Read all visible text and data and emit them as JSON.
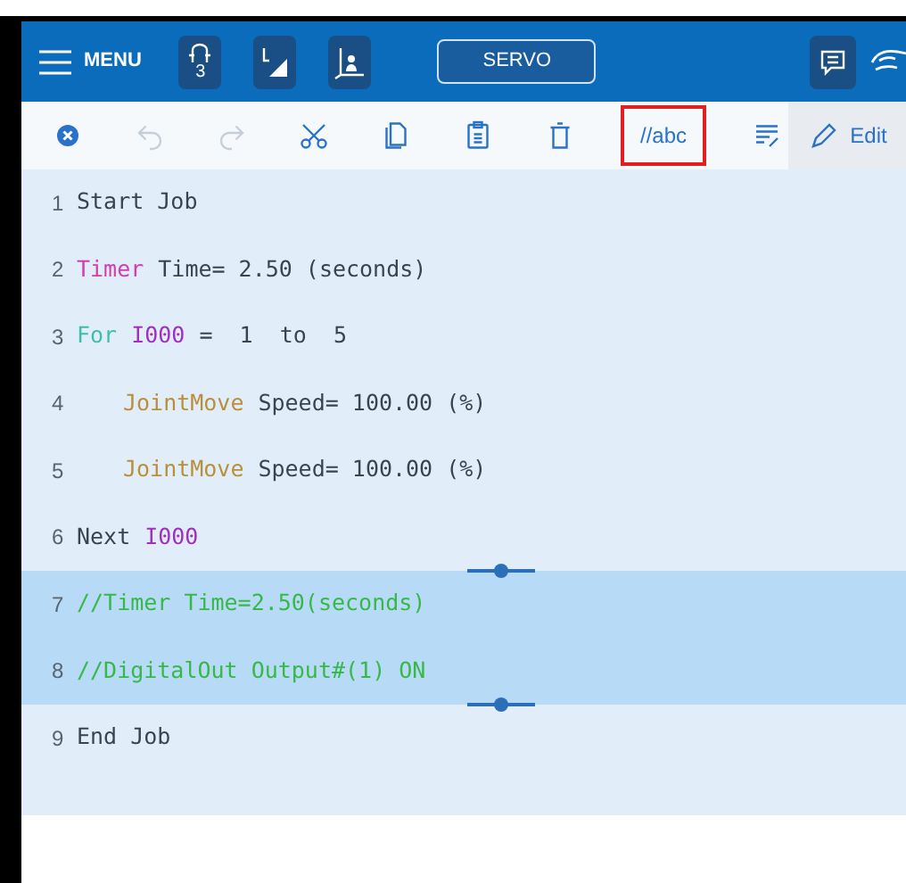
{
  "header": {
    "menu_label": "MENU",
    "robot_badge": "3",
    "servo_label": "SERVO"
  },
  "toolbar": [
    {
      "kind": "close",
      "disabled": false,
      "highlighted": false
    },
    {
      "kind": "undo",
      "disabled": true,
      "highlighted": false
    },
    {
      "kind": "redo",
      "disabled": true,
      "highlighted": false
    },
    {
      "kind": "cut",
      "disabled": false,
      "highlighted": false
    },
    {
      "kind": "copy",
      "disabled": false,
      "highlighted": false
    },
    {
      "kind": "paste",
      "disabled": false,
      "highlighted": false
    },
    {
      "kind": "delete",
      "disabled": false,
      "highlighted": false
    },
    {
      "kind": "comment",
      "label": "//abc",
      "disabled": false,
      "highlighted": true
    },
    {
      "kind": "format",
      "disabled": false,
      "highlighted": false
    },
    {
      "kind": "edit",
      "label": "Edit",
      "disabled": false,
      "highlighted": false
    }
  ],
  "lines": [
    {
      "number": "1",
      "selected": false,
      "tokens": [
        {
          "kind": "plain",
          "text": "Start Job"
        }
      ]
    },
    {
      "number": "2",
      "selected": false,
      "tokens": [
        {
          "kind": "command",
          "text": "Timer"
        },
        {
          "kind": "plain",
          "text": "Time= 2.50 (seconds)"
        }
      ]
    },
    {
      "number": "3",
      "selected": false,
      "tokens": [
        {
          "kind": "control",
          "text": "For"
        },
        {
          "kind": "variable",
          "text": "I000"
        },
        {
          "kind": "plain",
          "text": "=  1  to  5"
        }
      ],
      "children": [
        {
          "number": "4",
          "selected": false,
          "tokens": [
            {
              "kind": "move",
              "text": "JointMove"
            },
            {
              "kind": "plain",
              "text": "Speed= 100.00 (%)"
            }
          ]
        },
        {
          "number": "5",
          "selected": false,
          "tokens": [
            {
              "kind": "move",
              "text": "JointMove"
            },
            {
              "kind": "plain",
              "text": "Speed= 100.00 (%)"
            }
          ]
        }
      ]
    },
    {
      "number": "6",
      "selected": false,
      "tokens": [
        {
          "kind": "plain",
          "text": "Next"
        },
        {
          "kind": "variable",
          "text": "I000"
        }
      ]
    },
    {
      "number": "7",
      "selected": true,
      "tokens": [
        {
          "kind": "comment",
          "text": "//Timer Time=2.50(seconds)"
        }
      ]
    },
    {
      "number": "8",
      "selected": true,
      "tokens": [
        {
          "kind": "comment",
          "text": "//DigitalOut Output#(1) ON"
        }
      ]
    },
    {
      "number": "9",
      "selected": false,
      "tokens": [
        {
          "kind": "plain",
          "text": "End Job"
        }
      ]
    }
  ]
}
